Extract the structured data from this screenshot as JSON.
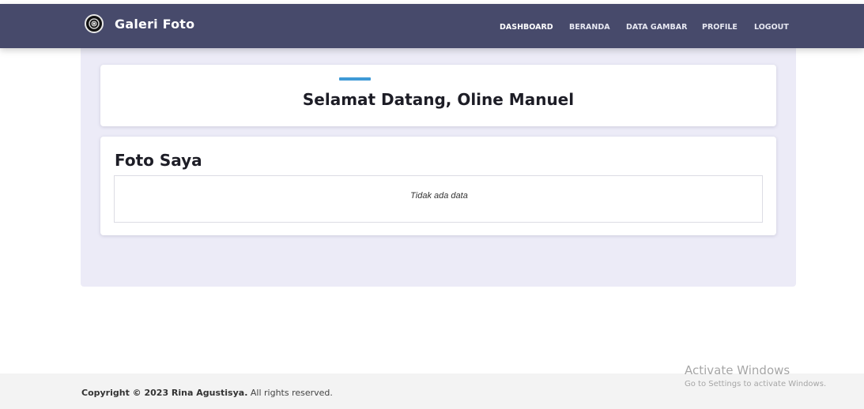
{
  "navbar": {
    "brand": "Galeri Foto",
    "links": [
      {
        "label": "DASHBOARD"
      },
      {
        "label": "BERANDA"
      },
      {
        "label": "DATA GAMBAR"
      },
      {
        "label": "PROFILE"
      },
      {
        "label": "LOGOUT"
      }
    ],
    "logo_icon": "camera-icon"
  },
  "welcome": {
    "title": "Selamat Datang, Oline Manuel"
  },
  "photos": {
    "title": "Foto Saya",
    "empty_text": "Tidak ada data"
  },
  "footer": {
    "owner": "Copyright © 2023 Rina Agustisya.",
    "rights": "All rights reserved."
  },
  "watermark": {
    "title": "Activate Windows",
    "subtitle": "Go to Settings to activate Windows."
  },
  "colors": {
    "navbar": "#474a6b",
    "accent": "#3e9ad6",
    "panel": "#ecebf7"
  }
}
